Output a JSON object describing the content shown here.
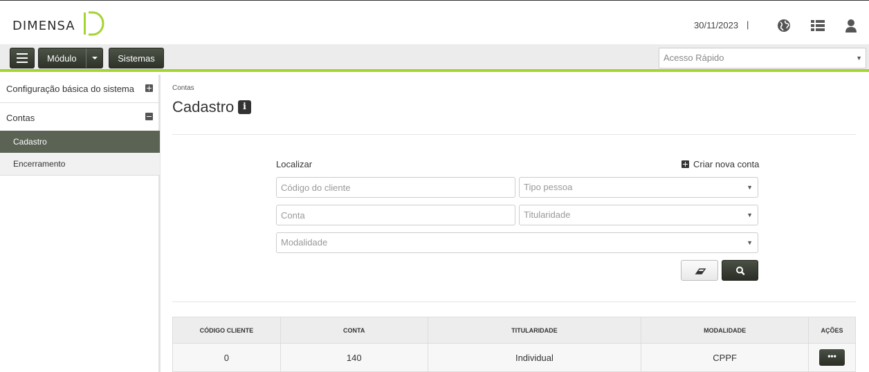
{
  "brand": {
    "name": "DIMENSA",
    "accent": "#a5d42f",
    "dark": "#3a3f35"
  },
  "header": {
    "date": "30/11/2023",
    "separator": "|",
    "icons": [
      "globe-icon",
      "list-icon",
      "user-icon"
    ]
  },
  "toolbar": {
    "modulo_label": "Módulo",
    "sistemas_label": "Sistemas",
    "quick_access_placeholder": "Acesso Rápido"
  },
  "sidebar": {
    "items": [
      {
        "label": "Configuração básica do sistema",
        "state": "collapsed"
      },
      {
        "label": "Contas",
        "state": "expanded"
      }
    ],
    "sub_items": [
      {
        "label": "Cadastro",
        "active": true
      },
      {
        "label": "Encerramento",
        "active": false
      }
    ]
  },
  "main": {
    "breadcrumb": "Contas",
    "title": "Cadastro",
    "info_icon_glyph": "i",
    "search": {
      "label": "Localizar",
      "new_account_label": "Criar nova conta",
      "fields": {
        "codigo_cliente": "Código do cliente",
        "tipo_pessoa": "Tipo pessoa",
        "conta": "Conta",
        "titularidade": "Titularidade",
        "modalidade": "Modalidade"
      }
    },
    "table": {
      "headers": [
        "CÓDIGO CLIENTE",
        "CONTA",
        "TITULARIDADE",
        "MODALIDADE",
        "AÇÕES"
      ],
      "rows": [
        {
          "codigo_cliente": "0",
          "conta": "140",
          "titularidade": "Individual",
          "modalidade": "CPPF",
          "acoes": "•••"
        }
      ]
    }
  }
}
